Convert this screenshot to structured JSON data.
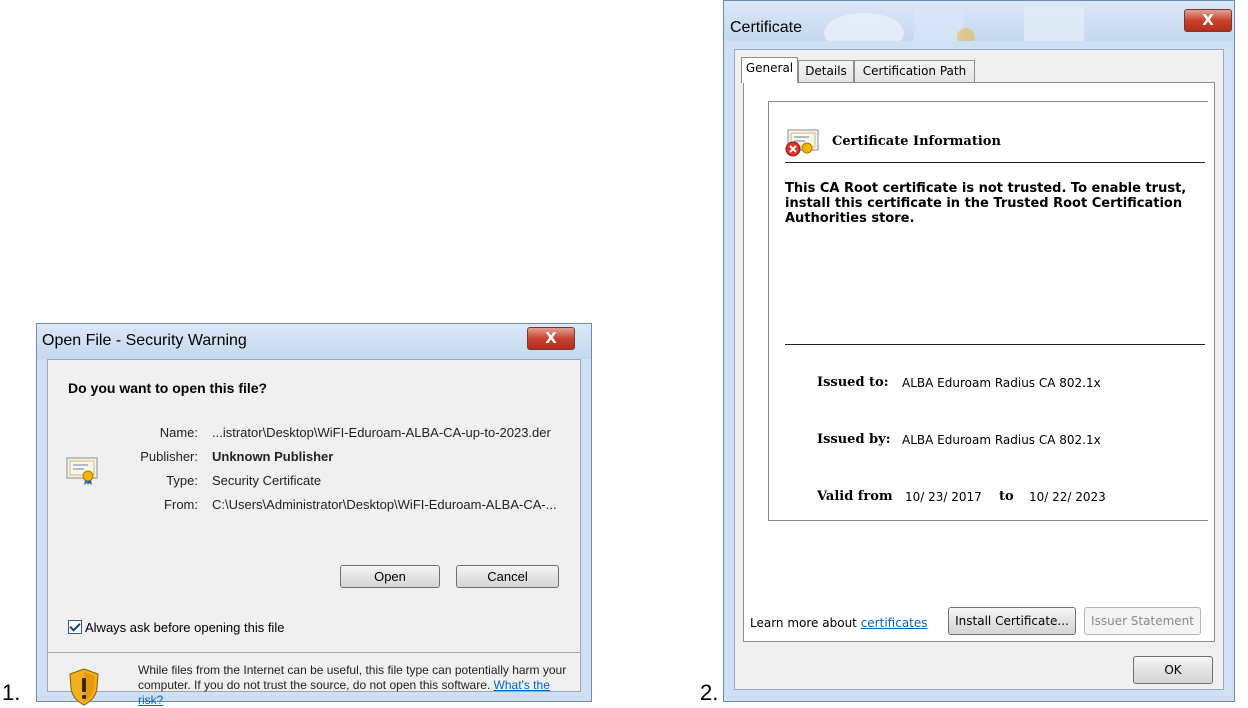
{
  "labels": {
    "step1": "1.",
    "step2": "2."
  },
  "dialog1": {
    "title": "Open File - Security Warning",
    "close_label": "X",
    "question": "Do you want to open this file?",
    "fields": {
      "name_label": "Name:",
      "name_value": "...istrator\\Desktop\\WiFI-Eduroam-ALBA-CA-up-to-2023.der",
      "publisher_label": "Publisher:",
      "publisher_value": "Unknown Publisher",
      "type_label": "Type:",
      "type_value": "Security Certificate",
      "from_label": "From:",
      "from_value": "C:\\Users\\Administrator\\Desktop\\WiFI-Eduroam-ALBA-CA-..."
    },
    "open_label": "Open",
    "cancel_label": "Cancel",
    "always_ask_label": "Always ask before opening this file",
    "always_ask_checked": true,
    "warning_text": "While files from the Internet can be useful, this file type can potentially harm your computer. If you do not trust the source, do not open this software.",
    "risk_link": "What's the risk?"
  },
  "dialog2": {
    "title": "Certificate",
    "close_label": "X",
    "tabs": [
      "General",
      "Details",
      "Certification Path"
    ],
    "info_title": "Certificate Information",
    "trust_message": "This CA Root certificate is not trusted. To enable trust, install this certificate in the Trusted Root Certification Authorities store.",
    "issued_to_label": "Issued to:",
    "issued_to_value": "ALBA Eduroam Radius CA 802.1x",
    "issued_by_label": "Issued by:",
    "issued_by_value": "ALBA Eduroam Radius CA 802.1x",
    "valid_from_label": "Valid from",
    "valid_from_value": "10/ 23/ 2017",
    "to_label": "to",
    "valid_to_value": "10/ 22/ 2023",
    "install_label": "Install Certificate...",
    "issuer_statement_label": "Issuer Statement",
    "learn_more_prefix": "Learn more about",
    "learn_more_link": "certificates",
    "ok_label": "OK"
  }
}
